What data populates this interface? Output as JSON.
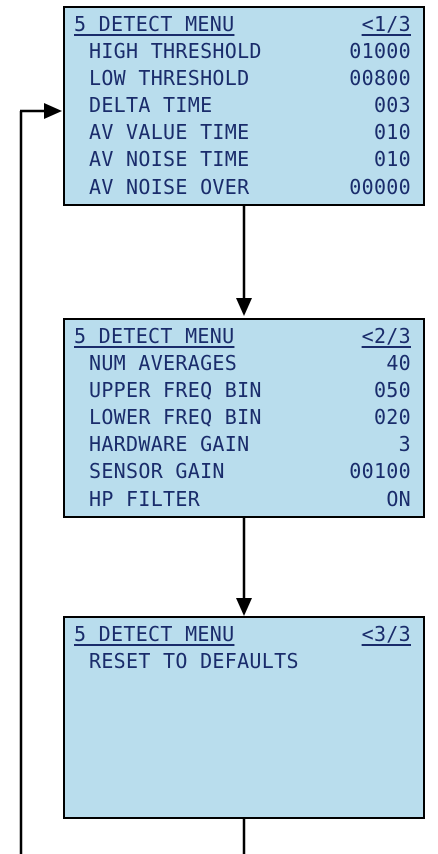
{
  "screens": [
    {
      "title": "5 DETECT MENU",
      "page": "<1/3",
      "rows": [
        {
          "label": "HIGH THRESHOLD",
          "value": "01000"
        },
        {
          "label": "LOW THRESHOLD",
          "value": "00800"
        },
        {
          "label": "DELTA TIME",
          "value": "003"
        },
        {
          "label": "AV VALUE TIME",
          "value": "010"
        },
        {
          "label": "AV NOISE TIME",
          "value": "010"
        },
        {
          "label": "AV NOISE OVER",
          "value": "00000"
        }
      ]
    },
    {
      "title": "5 DETECT MENU",
      "page": "<2/3",
      "rows": [
        {
          "label": "NUM AVERAGES",
          "value": "40"
        },
        {
          "label": "UPPER FREQ BIN",
          "value": "050"
        },
        {
          "label": "LOWER FREQ BIN",
          "value": "020"
        },
        {
          "label": "HARDWARE GAIN",
          "value": "3"
        },
        {
          "label": "SENSOR GAIN",
          "value": "00100"
        },
        {
          "label": "HP FILTER",
          "value": "ON"
        }
      ]
    },
    {
      "title": "5 DETECT MENU",
      "page": "<3/3",
      "rows": [
        {
          "label": "RESET TO DEFAULTS",
          "value": ""
        }
      ]
    }
  ],
  "colors": {
    "screen_background": "#b9dded",
    "text": "#1a2c6b",
    "border": "#000000",
    "arrow": "#000000"
  }
}
